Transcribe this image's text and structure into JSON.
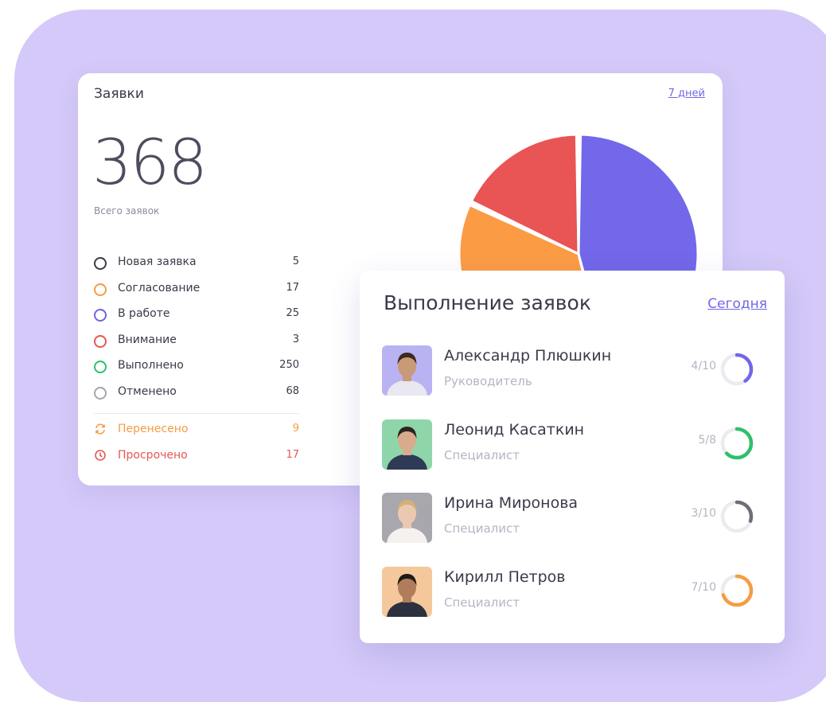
{
  "requests_card": {
    "title": "Заявки",
    "period_link": "7 дней",
    "total": "368",
    "total_label": "Всего заявок",
    "statuses": [
      {
        "label": "Новая заявка",
        "value": "5",
        "color": "#3b3a4a"
      },
      {
        "label": "Согласование",
        "value": "17",
        "color": "#f59c44"
      },
      {
        "label": "В работе",
        "value": "25",
        "color": "#6f63e6"
      },
      {
        "label": "Внимание",
        "value": "3",
        "color": "#e85651"
      },
      {
        "label": "Выполнено",
        "value": "250",
        "color": "#2ec06b"
      },
      {
        "label": "Отменено",
        "value": "68",
        "color": "#a6a4b2"
      }
    ],
    "special_statuses": [
      {
        "label": "Перенесено",
        "value": "9",
        "color": "#f59c44",
        "icon": "refresh-icon"
      },
      {
        "label": "Просрочено",
        "value": "17",
        "color": "#e85651",
        "icon": "clock-icon"
      }
    ]
  },
  "pie_slices": [
    {
      "fraction": 0.46,
      "color": "#7367ea"
    },
    {
      "fraction": 0.36,
      "color": "#fb9c45"
    },
    {
      "fraction": 0.18,
      "color": "#e95454"
    }
  ],
  "performance_card": {
    "title": "Выполнение заявок",
    "period_link": "Сегодня",
    "people": [
      {
        "name": "Александр Плюшкин",
        "role": "Руководитель",
        "ratio": "4/10",
        "done": 4,
        "total": 10,
        "color": "#7266e8",
        "avatar_bg": "#b9b2f3",
        "skin": "#c99a78",
        "hair": "#3a2a20",
        "shirt": "#e9e7ef"
      },
      {
        "name": "Леонид Касаткин",
        "role": "Специалист",
        "ratio": "5/8",
        "done": 5,
        "total": 8,
        "color": "#2ec06b",
        "avatar_bg": "#8ed6a9",
        "skin": "#d7ab8c",
        "hair": "#2d241f",
        "shirt": "#2f3a56"
      },
      {
        "name": "Ирина Миронова",
        "role": "Специалист",
        "ratio": "3/10",
        "done": 3,
        "total": 10,
        "color": "#6e6e78",
        "avatar_bg": "#a8a7ad",
        "skin": "#ebc9b1",
        "hair": "#d3b07a",
        "shirt": "#f4f1ee"
      },
      {
        "name": "Кирилл Петров",
        "role": "Специалист",
        "ratio": "7/10",
        "done": 7,
        "total": 10,
        "color": "#f59c44",
        "avatar_bg": "#f5c89b",
        "skin": "#b07c5b",
        "hair": "#1e1b1a",
        "shirt": "#2c3140"
      }
    ]
  }
}
